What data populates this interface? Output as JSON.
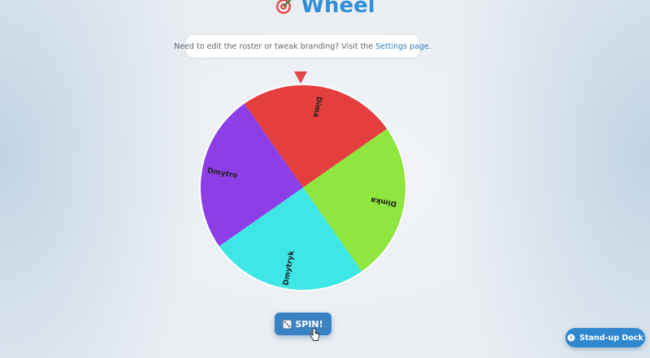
{
  "app": {
    "title": "Wheel",
    "logo_icon": "target-dart-icon"
  },
  "notice": {
    "text": "Need to edit the roster or tweak branding? Visit the",
    "link_label": "Settings page",
    "suffix": "."
  },
  "wheel": {
    "pointer_icon": "triangle-pointer-icon",
    "segments": [
      {
        "name": "Dima",
        "color": "#e53e3e"
      },
      {
        "name": "Dimka",
        "color": "#8ee63e"
      },
      {
        "name": "Dmytryk",
        "color": "#3ee6e6"
      },
      {
        "name": "Dmytro",
        "color": "#8e3ee6"
      }
    ]
  },
  "spin": {
    "label": "SPIN!",
    "icon": "dice-icon"
  },
  "dock": {
    "label": "Stand-up Dock",
    "icon": "compass-icon"
  }
}
